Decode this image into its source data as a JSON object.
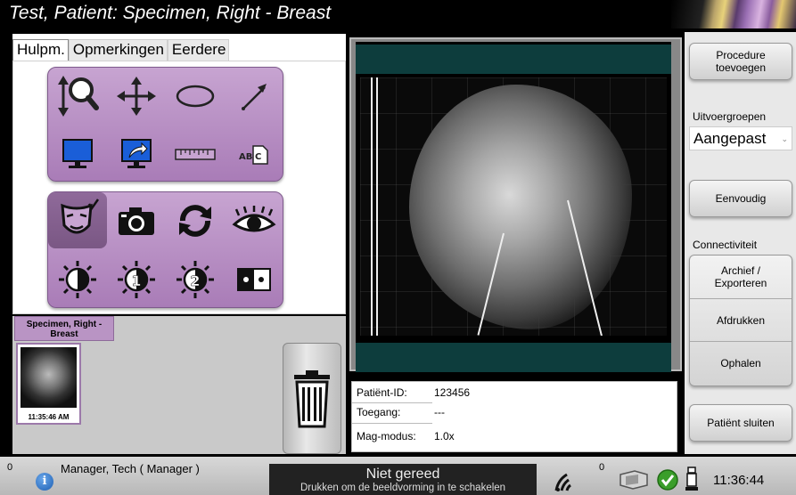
{
  "title": "Test, Patient:  Specimen, Right - Breast",
  "tabs": [
    {
      "label": "Hulpm."
    },
    {
      "label": "Opmerkingen"
    },
    {
      "label": "Eerdere"
    }
  ],
  "tools_group1": [
    {
      "icon": "zoom-icon"
    },
    {
      "icon": "pan-icon"
    },
    {
      "icon": "ellipse-icon"
    },
    {
      "icon": "arrow-icon"
    },
    {
      "icon": "monitor-icon"
    },
    {
      "icon": "export-icon"
    },
    {
      "icon": "ruler-icon"
    },
    {
      "icon": "text-annotation-icon"
    }
  ],
  "tools_group2": [
    {
      "icon": "face-check-icon"
    },
    {
      "icon": "camera-icon"
    },
    {
      "icon": "refresh-icon"
    },
    {
      "icon": "eye-icon"
    },
    {
      "icon": "invert-icon"
    },
    {
      "icon": "window-level-1-icon",
      "num": "1"
    },
    {
      "icon": "window-level-2-icon",
      "num": "2"
    },
    {
      "icon": "dual-display-icon"
    }
  ],
  "thumbnail": {
    "tab_label": "Specimen, Right - Breast",
    "time": "11:35:46 AM"
  },
  "info": {
    "patient_id_label": "Patiënt-ID:",
    "patient_id": "123456",
    "access_label": "Toegang:",
    "access": "---",
    "mag_label": "Mag-modus:",
    "mag": "1.0x"
  },
  "right": {
    "add_procedure": "Procedure toevoegen",
    "output_groups_label": "Uitvoergroepen",
    "output_group_value": "Aangepast",
    "simple": "Eenvoudig",
    "connectivity_label": "Connectiviteit",
    "archive": "Archief / Exporteren",
    "print": "Afdrukken",
    "retrieve": "Ophalen",
    "close_patient": "Patiënt sluiten"
  },
  "status": {
    "count_left": "0",
    "user": "Manager, Tech ( Manager )",
    "state": "Niet gereed",
    "state_sub": "Drukken om de beeldvorming in te schakelen",
    "count_right": "0",
    "time": "11:36:44"
  },
  "colors": {
    "tool_purple": "#b48cc2",
    "viewer_band": "#0d3d3d"
  }
}
